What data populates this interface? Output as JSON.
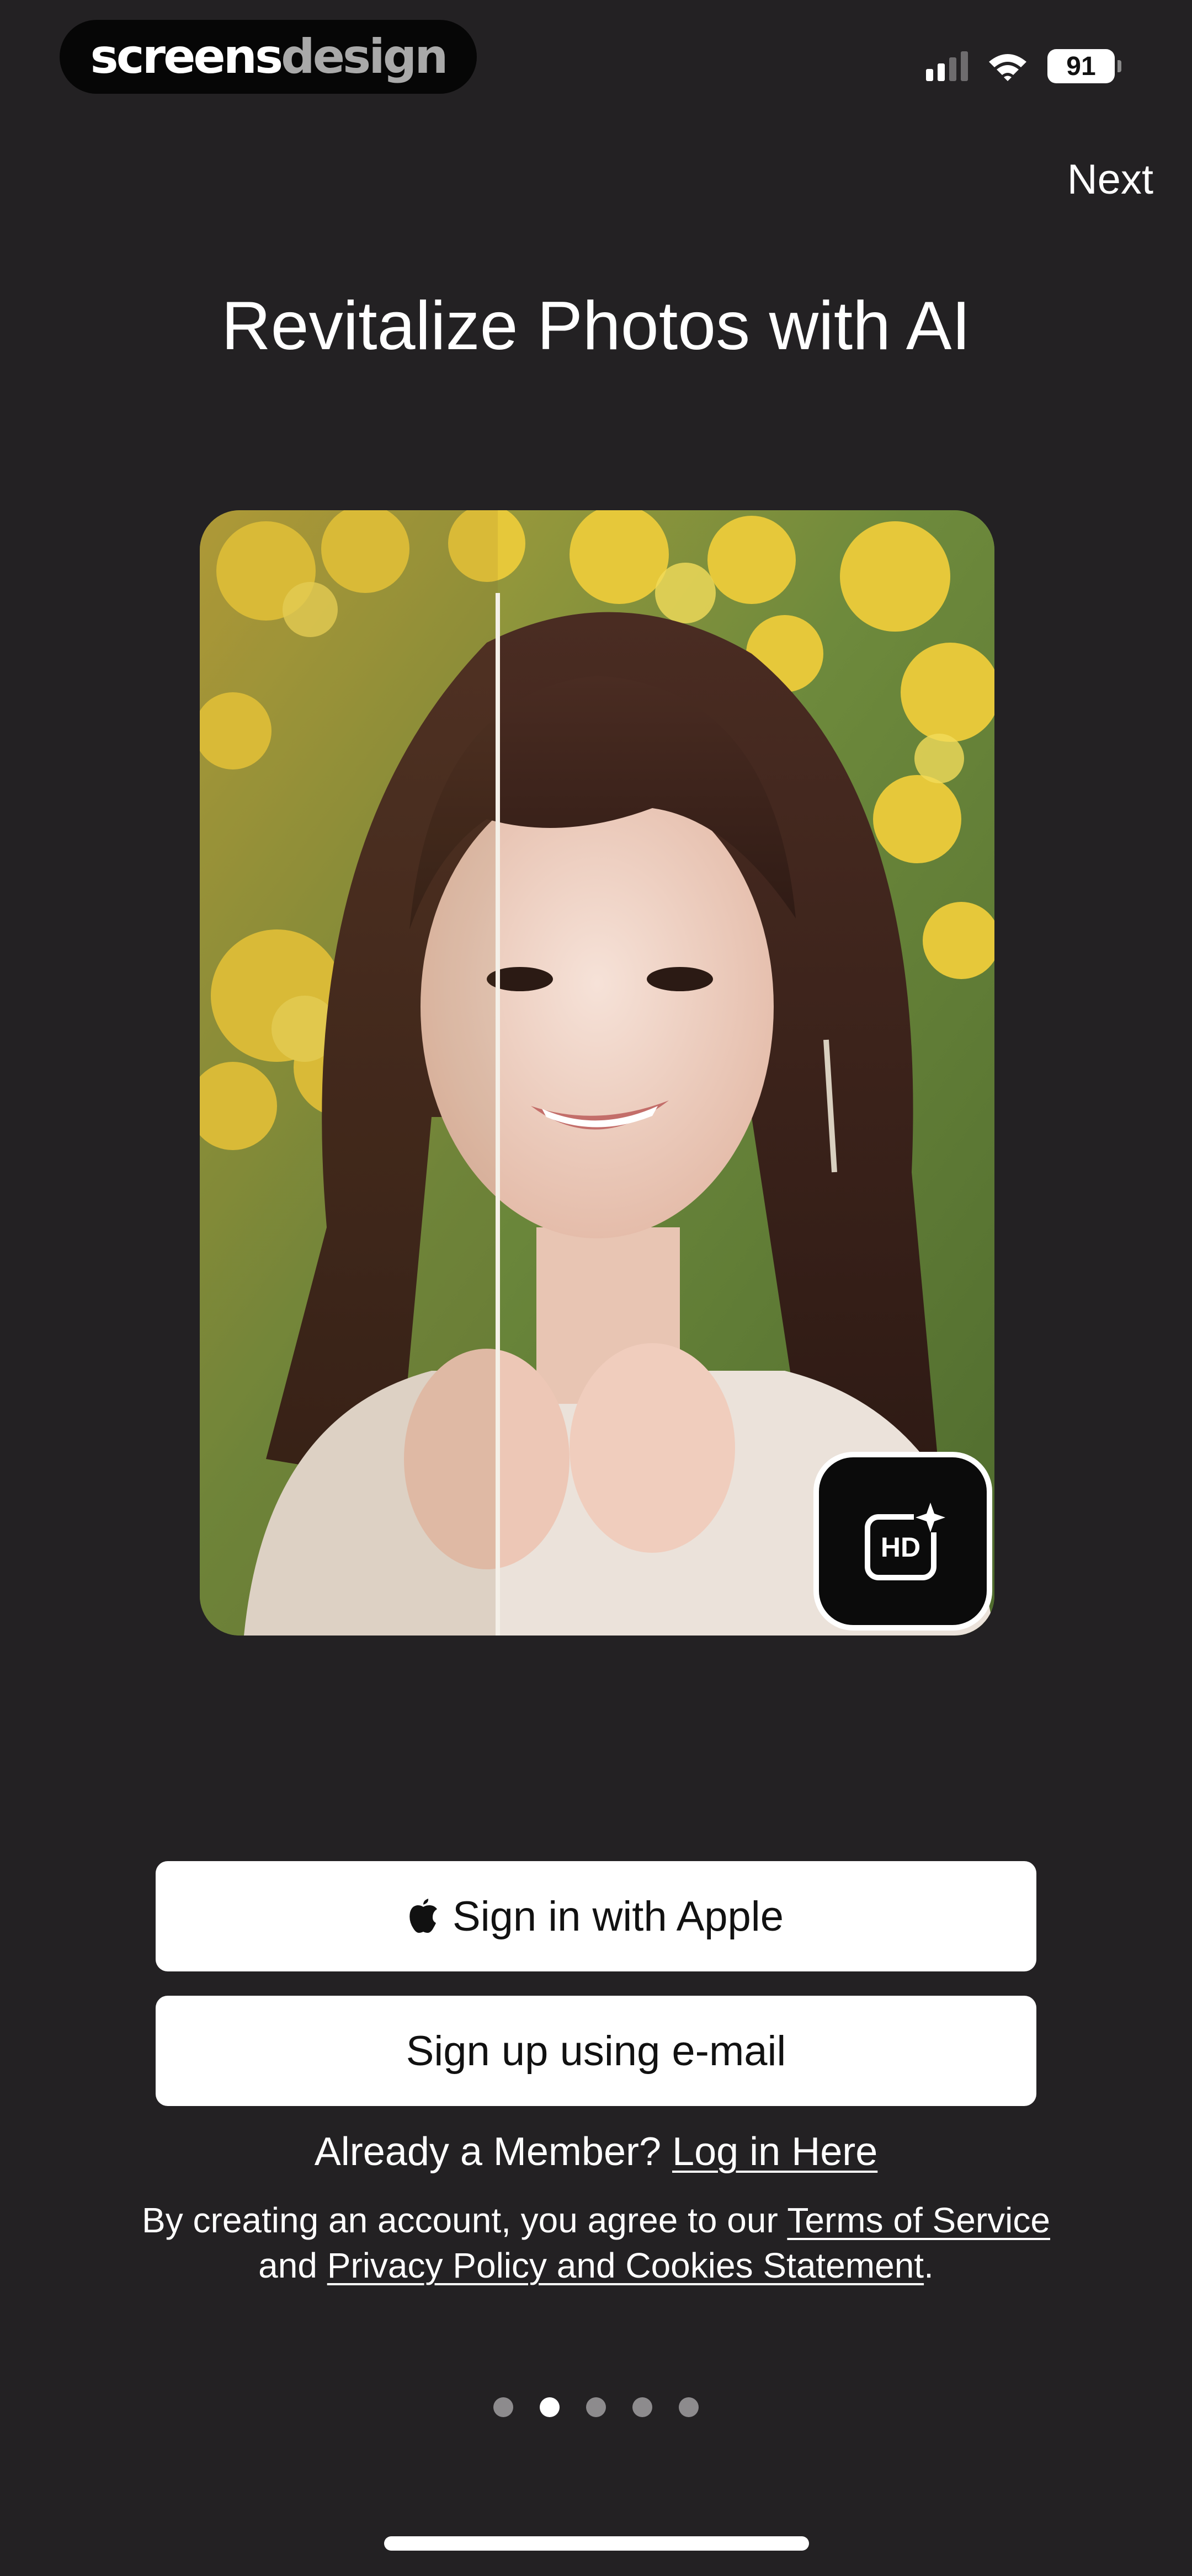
{
  "status_bar": {
    "watermark_part1": "screens",
    "watermark_part2": "design",
    "battery_level": "91",
    "icons": [
      "cellular-signal-icon",
      "wifi-icon",
      "battery-icon"
    ]
  },
  "header": {
    "next_label": "Next"
  },
  "main": {
    "title": "Revitalize Photos with AI",
    "image": {
      "description_icon": "before-after-photo",
      "badge_text": "HD",
      "badge_icon": "hd-sparkle-icon"
    }
  },
  "auth": {
    "apple_label": "Sign in with Apple",
    "email_label": "Sign up using e-mail",
    "member_prefix": "Already a Member?",
    "login_link": "Log in Here",
    "legal_prefix": "By creating an account, you agree to our",
    "terms_link": "Terms of Service",
    "legal_and": "and",
    "privacy_link": "Privacy Policy and Cookies Statement",
    "legal_end": "."
  },
  "pagination": {
    "total": 5,
    "active_index": 1
  },
  "colors": {
    "background": "#232123",
    "button": "#ffffff",
    "text": "#ffffff",
    "dot_inactive": "#8d8b8d"
  }
}
